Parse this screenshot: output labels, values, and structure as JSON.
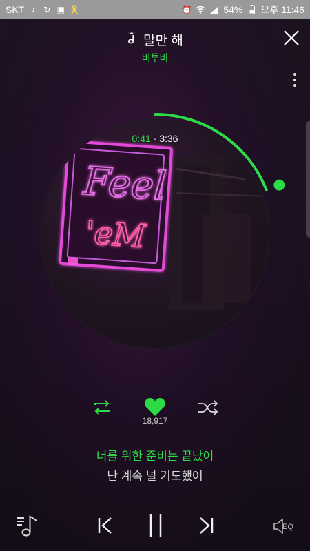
{
  "status_bar": {
    "carrier": "SKT",
    "battery": "54%",
    "time": "오후 11:46"
  },
  "song": {
    "title": "말만 해",
    "artist": "비투비",
    "current_time": "0:41",
    "separator": "·",
    "total_time": "3:36",
    "progress_fraction": 0.19
  },
  "album_art": {
    "sign_text_line1": "Feel",
    "sign_text_line2": "'eM"
  },
  "controls": {
    "like_count": "18,917"
  },
  "lyrics": {
    "current": "너를 위한 준비는 끝났어",
    "next": "난 계속 널 기도했어"
  },
  "bottom": {
    "eq_label": "EQ"
  },
  "colors": {
    "accent": "#2bdc46",
    "neon_pink": "#e24bd8",
    "status_bar": "#9a9a9a"
  }
}
